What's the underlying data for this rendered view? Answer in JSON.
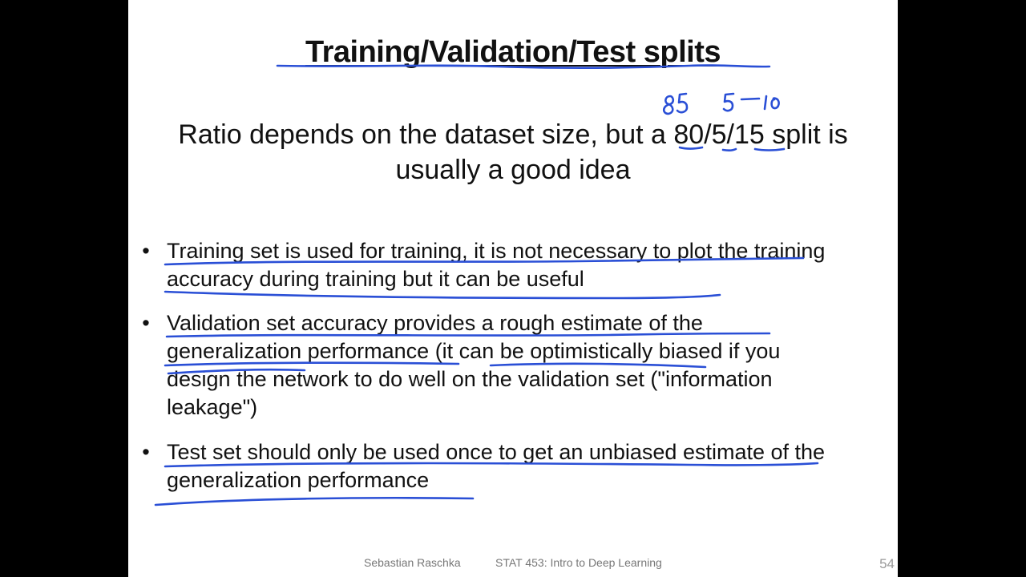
{
  "slide": {
    "title": "Training/Validation/Test splits",
    "subtitle_line1": "Ratio depends on the dataset size, but a 80/5/15 split is",
    "subtitle_line2": "usually a good idea",
    "bullets": [
      {
        "marker": "•",
        "text": "Training set is used for training, it is not necessary to plot the training accuracy during training but it can be useful"
      },
      {
        "marker": "•",
        "text": "Validation set accuracy provides a rough estimate of the generalization performance (it can be optimistically biased if you design the network to do well on the validation set (\"information leakage\")"
      },
      {
        "marker": "•",
        "text": "Test set should only be used once to get an unbiased estimate of the generalization performance"
      }
    ],
    "footer_author": "Sebastian Raschka",
    "footer_course": "STAT 453: Intro to Deep Learning",
    "page_number": "54"
  },
  "annotations": {
    "handwritten_ratio": "85  5  10",
    "ink_color": "#2a4fd6"
  }
}
